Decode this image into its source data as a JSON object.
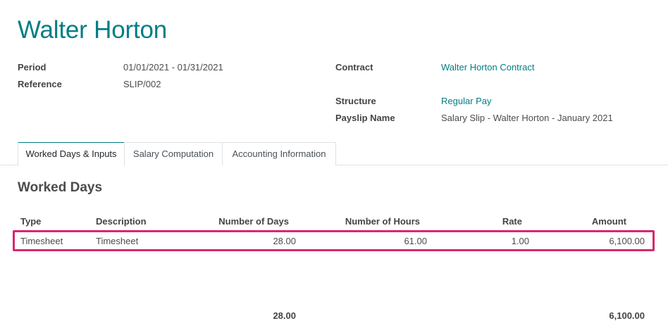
{
  "record": {
    "title": "Walter Horton"
  },
  "fields": {
    "period_label": "Period",
    "period_value": "01/01/2021 - 01/31/2021",
    "reference_label": "Reference",
    "reference_value": "SLIP/002",
    "contract_label": "Contract",
    "contract_value": "Walter Horton Contract",
    "structure_label": "Structure",
    "structure_value": "Regular Pay",
    "payslip_name_label": "Payslip Name",
    "payslip_name_value": "Salary Slip - Walter Horton - January 2021"
  },
  "tabs": [
    {
      "label": "Worked Days & Inputs",
      "active": true
    },
    {
      "label": "Salary Computation",
      "active": false
    },
    {
      "label": "Accounting Information",
      "active": false
    }
  ],
  "worked_days": {
    "section_title": "Worked Days",
    "columns": [
      "Type",
      "Description",
      "Number of Days",
      "Number of Hours",
      "Rate",
      "Amount"
    ],
    "rows": [
      {
        "type": "Timesheet",
        "description": "Timesheet",
        "days": "28.00",
        "hours": "61.00",
        "rate": "1.00",
        "amount": "6,100.00"
      }
    ],
    "totals": {
      "days": "28.00",
      "amount": "6,100.00"
    }
  },
  "colors": {
    "accent": "#017e84",
    "highlight": "#d6286e"
  }
}
